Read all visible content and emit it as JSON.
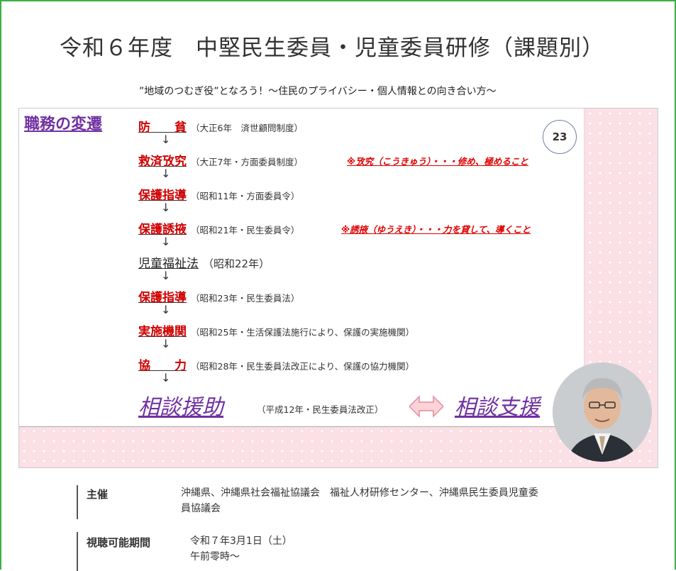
{
  "page": {
    "title": "令和６年度　中堅民生委員・児童委員研修（課題別）",
    "subtitle": "”地域のつむぎ役”となろう！～住民のプライバシー・個人情報との向き合い方～"
  },
  "slide": {
    "heading": "職務の変遷",
    "number": "23",
    "eras": [
      {
        "name": "防　　貧",
        "note": "（大正6年　済世顧問制度）"
      },
      {
        "name": "救済攷究",
        "note": "（大正7年・方面委員制度）",
        "remark": "※攷究（こうきゅう）・・・修め、極めること"
      },
      {
        "name": "保護指導",
        "note": "（昭和11年・方面委員令）"
      },
      {
        "name": "保護誘掖",
        "note": "（昭和21年・民生委員令）",
        "remark": "※誘掖（ゆうえき）・・・力を貸して、導くこと"
      },
      {
        "name": "児童福祉法",
        "note": "（昭和22年）"
      },
      {
        "name": "保護指導",
        "note": "（昭和23年・民生委員法）"
      },
      {
        "name": "実施機関",
        "note": "（昭和25年・生活保護法施行により、保護の実施機関）"
      },
      {
        "name": "協　　力",
        "note": "（昭和28年・民生委員法改正により、保護の協力機関）"
      }
    ],
    "arrow_glyph": "↓",
    "final": {
      "name": "相談援助",
      "note": "（平成12年・民生委員法改正）",
      "name2": "相談支援"
    }
  },
  "info": {
    "organizer": {
      "label": "主催",
      "lines": [
        "沖縄県、沖縄県社会福祉協議会　福祉人材研修センター、沖縄県民生委員児童委",
        "員協議会"
      ]
    },
    "period": {
      "label": "視聴可能期間",
      "lines": [
        "令和７年3月1日（土）",
        "午前零時～"
      ]
    }
  },
  "colors": {
    "frame": "#3cb043",
    "heading_purple": "#7030a0",
    "era_red": "#d00000",
    "pink_bg": "#fbe0e6"
  }
}
